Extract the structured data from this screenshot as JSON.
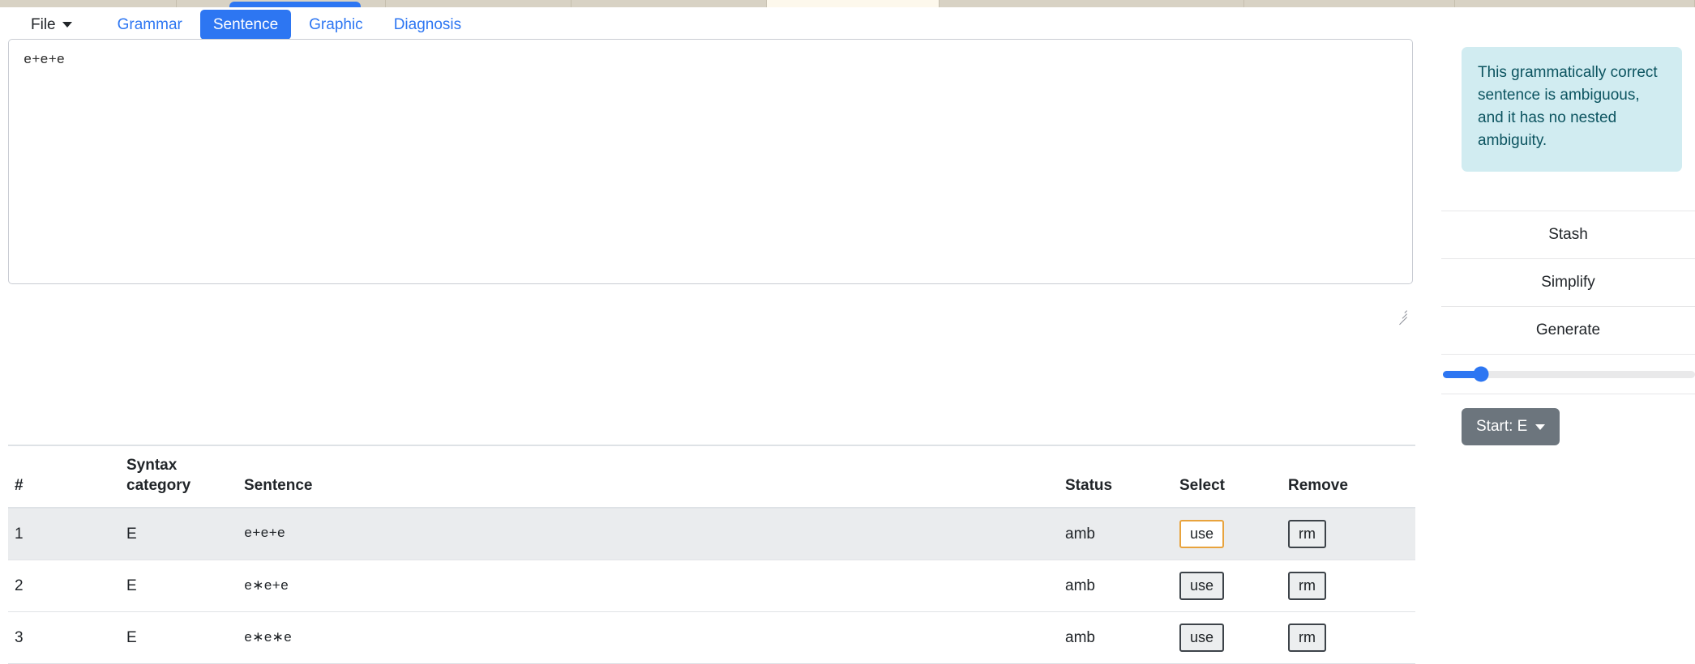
{
  "window": {
    "browser_tabs": [
      {
        "active": false
      },
      {
        "active": false
      },
      {
        "active": false
      },
      {
        "active": false
      },
      {
        "active": true
      },
      {
        "active": false
      },
      {
        "active": false
      },
      {
        "active": false
      }
    ]
  },
  "navbar": {
    "file_label": "File",
    "items": [
      {
        "label": "Grammar",
        "active": false
      },
      {
        "label": "Sentence",
        "active": true
      },
      {
        "label": "Graphic",
        "active": false
      },
      {
        "label": "Diagnosis",
        "active": false
      }
    ],
    "link_color": "#2d76f2",
    "active_bg": "#2d76f2"
  },
  "editor": {
    "value": "e+e+e",
    "placeholder": ""
  },
  "table": {
    "headers": {
      "num": "#",
      "category": "Syntax category",
      "sentence": "Sentence",
      "status": "Status",
      "select": "Select",
      "remove": "Remove"
    },
    "rows": [
      {
        "num": "1",
        "category": "E",
        "sentence": "e+e+e",
        "status": "amb",
        "select_label": "use",
        "remove_label": "rm",
        "highlighted": true,
        "select_active": true
      },
      {
        "num": "2",
        "category": "E",
        "sentence": "e∗e+e",
        "status": "amb",
        "select_label": "use",
        "remove_label": "rm",
        "highlighted": false,
        "select_active": false
      },
      {
        "num": "3",
        "category": "E",
        "sentence": "e∗e∗e",
        "status": "amb",
        "select_label": "use",
        "remove_label": "rm",
        "highlighted": false,
        "select_active": false
      }
    ]
  },
  "sidebar": {
    "info_message": "This grammatically correct sentence is ambiguous, and it has no nested ambiguity.",
    "info_bg": "#d1ecf1",
    "info_fg": "#0c5460",
    "actions": [
      {
        "label": "Stash"
      },
      {
        "label": "Simplify"
      },
      {
        "label": "Generate"
      }
    ],
    "slider": {
      "percent": 15,
      "accent": "#2d76f2"
    },
    "start_button": {
      "label": "Start: E",
      "bg": "#6c757d"
    }
  }
}
